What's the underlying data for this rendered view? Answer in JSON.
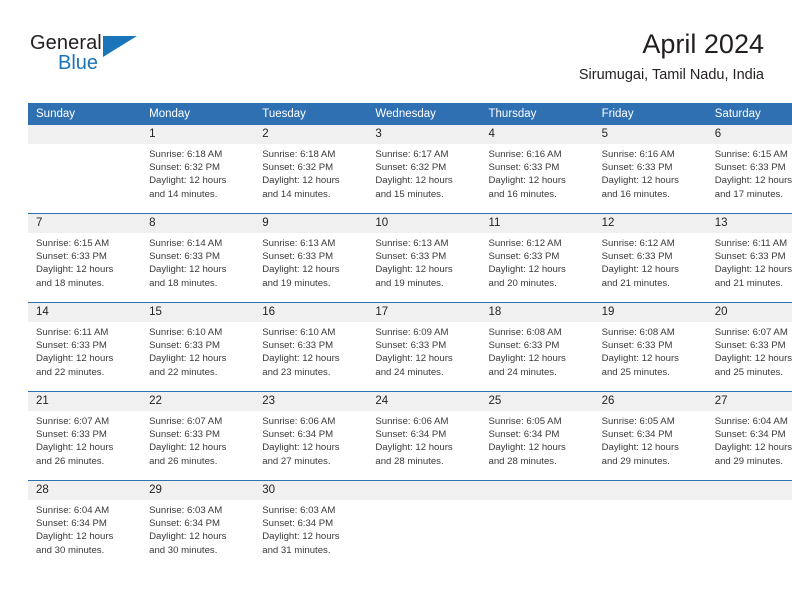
{
  "brand": {
    "name_line1": "General",
    "name_line2": "Blue",
    "logo_accent": "#1b75bb"
  },
  "header": {
    "title": "April 2024",
    "location": "Sirumugai, Tamil Nadu, India"
  },
  "theme": {
    "header_blue": "#2f70b3",
    "daynum_band": "#f0f0f0",
    "text": "#231f20"
  },
  "weekday_headers": [
    "Sunday",
    "Monday",
    "Tuesday",
    "Wednesday",
    "Thursday",
    "Friday",
    "Saturday"
  ],
  "weeks": [
    [
      {
        "day": "",
        "sunrise": "",
        "sunset": "",
        "daylight1": "",
        "daylight2": ""
      },
      {
        "day": "1",
        "sunrise": "Sunrise: 6:18 AM",
        "sunset": "Sunset: 6:32 PM",
        "daylight1": "Daylight: 12 hours",
        "daylight2": "and 14 minutes."
      },
      {
        "day": "2",
        "sunrise": "Sunrise: 6:18 AM",
        "sunset": "Sunset: 6:32 PM",
        "daylight1": "Daylight: 12 hours",
        "daylight2": "and 14 minutes."
      },
      {
        "day": "3",
        "sunrise": "Sunrise: 6:17 AM",
        "sunset": "Sunset: 6:32 PM",
        "daylight1": "Daylight: 12 hours",
        "daylight2": "and 15 minutes."
      },
      {
        "day": "4",
        "sunrise": "Sunrise: 6:16 AM",
        "sunset": "Sunset: 6:33 PM",
        "daylight1": "Daylight: 12 hours",
        "daylight2": "and 16 minutes."
      },
      {
        "day": "5",
        "sunrise": "Sunrise: 6:16 AM",
        "sunset": "Sunset: 6:33 PM",
        "daylight1": "Daylight: 12 hours",
        "daylight2": "and 16 minutes."
      },
      {
        "day": "6",
        "sunrise": "Sunrise: 6:15 AM",
        "sunset": "Sunset: 6:33 PM",
        "daylight1": "Daylight: 12 hours",
        "daylight2": "and 17 minutes."
      }
    ],
    [
      {
        "day": "7",
        "sunrise": "Sunrise: 6:15 AM",
        "sunset": "Sunset: 6:33 PM",
        "daylight1": "Daylight: 12 hours",
        "daylight2": "and 18 minutes."
      },
      {
        "day": "8",
        "sunrise": "Sunrise: 6:14 AM",
        "sunset": "Sunset: 6:33 PM",
        "daylight1": "Daylight: 12 hours",
        "daylight2": "and 18 minutes."
      },
      {
        "day": "9",
        "sunrise": "Sunrise: 6:13 AM",
        "sunset": "Sunset: 6:33 PM",
        "daylight1": "Daylight: 12 hours",
        "daylight2": "and 19 minutes."
      },
      {
        "day": "10",
        "sunrise": "Sunrise: 6:13 AM",
        "sunset": "Sunset: 6:33 PM",
        "daylight1": "Daylight: 12 hours",
        "daylight2": "and 19 minutes."
      },
      {
        "day": "11",
        "sunrise": "Sunrise: 6:12 AM",
        "sunset": "Sunset: 6:33 PM",
        "daylight1": "Daylight: 12 hours",
        "daylight2": "and 20 minutes."
      },
      {
        "day": "12",
        "sunrise": "Sunrise: 6:12 AM",
        "sunset": "Sunset: 6:33 PM",
        "daylight1": "Daylight: 12 hours",
        "daylight2": "and 21 minutes."
      },
      {
        "day": "13",
        "sunrise": "Sunrise: 6:11 AM",
        "sunset": "Sunset: 6:33 PM",
        "daylight1": "Daylight: 12 hours",
        "daylight2": "and 21 minutes."
      }
    ],
    [
      {
        "day": "14",
        "sunrise": "Sunrise: 6:11 AM",
        "sunset": "Sunset: 6:33 PM",
        "daylight1": "Daylight: 12 hours",
        "daylight2": "and 22 minutes."
      },
      {
        "day": "15",
        "sunrise": "Sunrise: 6:10 AM",
        "sunset": "Sunset: 6:33 PM",
        "daylight1": "Daylight: 12 hours",
        "daylight2": "and 22 minutes."
      },
      {
        "day": "16",
        "sunrise": "Sunrise: 6:10 AM",
        "sunset": "Sunset: 6:33 PM",
        "daylight1": "Daylight: 12 hours",
        "daylight2": "and 23 minutes."
      },
      {
        "day": "17",
        "sunrise": "Sunrise: 6:09 AM",
        "sunset": "Sunset: 6:33 PM",
        "daylight1": "Daylight: 12 hours",
        "daylight2": "and 24 minutes."
      },
      {
        "day": "18",
        "sunrise": "Sunrise: 6:08 AM",
        "sunset": "Sunset: 6:33 PM",
        "daylight1": "Daylight: 12 hours",
        "daylight2": "and 24 minutes."
      },
      {
        "day": "19",
        "sunrise": "Sunrise: 6:08 AM",
        "sunset": "Sunset: 6:33 PM",
        "daylight1": "Daylight: 12 hours",
        "daylight2": "and 25 minutes."
      },
      {
        "day": "20",
        "sunrise": "Sunrise: 6:07 AM",
        "sunset": "Sunset: 6:33 PM",
        "daylight1": "Daylight: 12 hours",
        "daylight2": "and 25 minutes."
      }
    ],
    [
      {
        "day": "21",
        "sunrise": "Sunrise: 6:07 AM",
        "sunset": "Sunset: 6:33 PM",
        "daylight1": "Daylight: 12 hours",
        "daylight2": "and 26 minutes."
      },
      {
        "day": "22",
        "sunrise": "Sunrise: 6:07 AM",
        "sunset": "Sunset: 6:33 PM",
        "daylight1": "Daylight: 12 hours",
        "daylight2": "and 26 minutes."
      },
      {
        "day": "23",
        "sunrise": "Sunrise: 6:06 AM",
        "sunset": "Sunset: 6:34 PM",
        "daylight1": "Daylight: 12 hours",
        "daylight2": "and 27 minutes."
      },
      {
        "day": "24",
        "sunrise": "Sunrise: 6:06 AM",
        "sunset": "Sunset: 6:34 PM",
        "daylight1": "Daylight: 12 hours",
        "daylight2": "and 28 minutes."
      },
      {
        "day": "25",
        "sunrise": "Sunrise: 6:05 AM",
        "sunset": "Sunset: 6:34 PM",
        "daylight1": "Daylight: 12 hours",
        "daylight2": "and 28 minutes."
      },
      {
        "day": "26",
        "sunrise": "Sunrise: 6:05 AM",
        "sunset": "Sunset: 6:34 PM",
        "daylight1": "Daylight: 12 hours",
        "daylight2": "and 29 minutes."
      },
      {
        "day": "27",
        "sunrise": "Sunrise: 6:04 AM",
        "sunset": "Sunset: 6:34 PM",
        "daylight1": "Daylight: 12 hours",
        "daylight2": "and 29 minutes."
      }
    ],
    [
      {
        "day": "28",
        "sunrise": "Sunrise: 6:04 AM",
        "sunset": "Sunset: 6:34 PM",
        "daylight1": "Daylight: 12 hours",
        "daylight2": "and 30 minutes."
      },
      {
        "day": "29",
        "sunrise": "Sunrise: 6:03 AM",
        "sunset": "Sunset: 6:34 PM",
        "daylight1": "Daylight: 12 hours",
        "daylight2": "and 30 minutes."
      },
      {
        "day": "30",
        "sunrise": "Sunrise: 6:03 AM",
        "sunset": "Sunset: 6:34 PM",
        "daylight1": "Daylight: 12 hours",
        "daylight2": "and 31 minutes."
      },
      {
        "day": "",
        "sunrise": "",
        "sunset": "",
        "daylight1": "",
        "daylight2": ""
      },
      {
        "day": "",
        "sunrise": "",
        "sunset": "",
        "daylight1": "",
        "daylight2": ""
      },
      {
        "day": "",
        "sunrise": "",
        "sunset": "",
        "daylight1": "",
        "daylight2": ""
      },
      {
        "day": "",
        "sunrise": "",
        "sunset": "",
        "daylight1": "",
        "daylight2": ""
      }
    ]
  ]
}
